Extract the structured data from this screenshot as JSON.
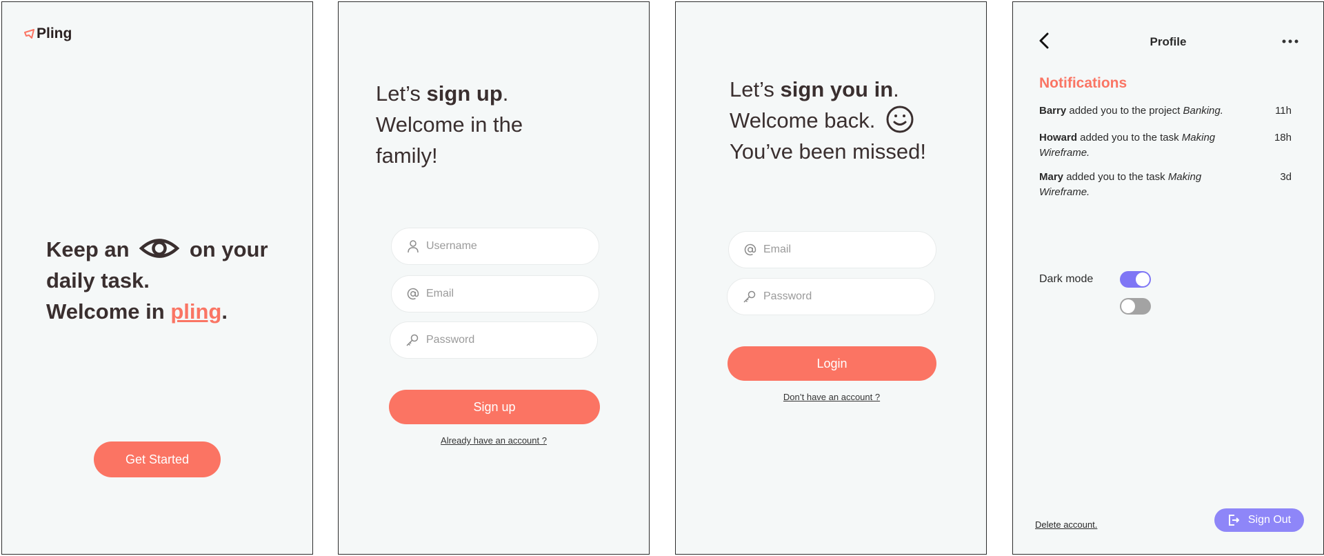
{
  "welcome": {
    "logo_text": "Pling",
    "hero_line1_a": "Keep an",
    "hero_line1_b": "on your",
    "hero_line2": "daily task.",
    "hero_line3_a": "Welcome in",
    "hero_line3_link": "pling",
    "hero_line3_end": ".",
    "cta_label": "Get Started"
  },
  "signup": {
    "heading_a": "Let’s",
    "heading_bold": "sign up",
    "heading_end": ".",
    "heading_line2": "Welcome in the",
    "heading_line3": "family!",
    "username_placeholder": "Username",
    "email_placeholder": "Email",
    "password_placeholder": "Password",
    "button_label": "Sign up",
    "alt_link": "Already have an account ?"
  },
  "login": {
    "heading_a": "Let’s",
    "heading_bold": "sign you in",
    "heading_end": ".",
    "heading_line2": "Welcome back.",
    "heading_line3": "You’ve been missed!",
    "email_placeholder": "Email",
    "password_placeholder": "Password",
    "button_label": "Login",
    "alt_link": "Don’t have an account ?"
  },
  "profile": {
    "title": "Profile",
    "notifications_title": "Notifications",
    "notifications": [
      {
        "user": "Barry",
        "text": " added you to the project ",
        "target": "Banking",
        "end": ".",
        "time": "11h"
      },
      {
        "user": "Howard",
        "text": " added you to the task ",
        "target": "Making Wireframe",
        "end": ".",
        "time": "18h"
      },
      {
        "user": "Mary",
        "text": " added you to the task ",
        "target": "Making Wireframe",
        "end": ".",
        "time": "3d"
      }
    ],
    "dark_mode_label": "Dark mode",
    "dark_mode_on": true,
    "second_toggle_on": false,
    "delete_link": "Delete account.",
    "sign_out_label": "Sign Out"
  },
  "colors": {
    "accent": "#fb7463",
    "toggle_on": "#7f76f5",
    "sign_out": "#8e86f8",
    "screen_bg": "#f5f8f8"
  },
  "icons": [
    "logo-icon",
    "eye-icon",
    "user-icon",
    "at-icon",
    "key-icon",
    "smiley-icon",
    "back-icon",
    "more-icon",
    "sign-out-icon"
  ]
}
